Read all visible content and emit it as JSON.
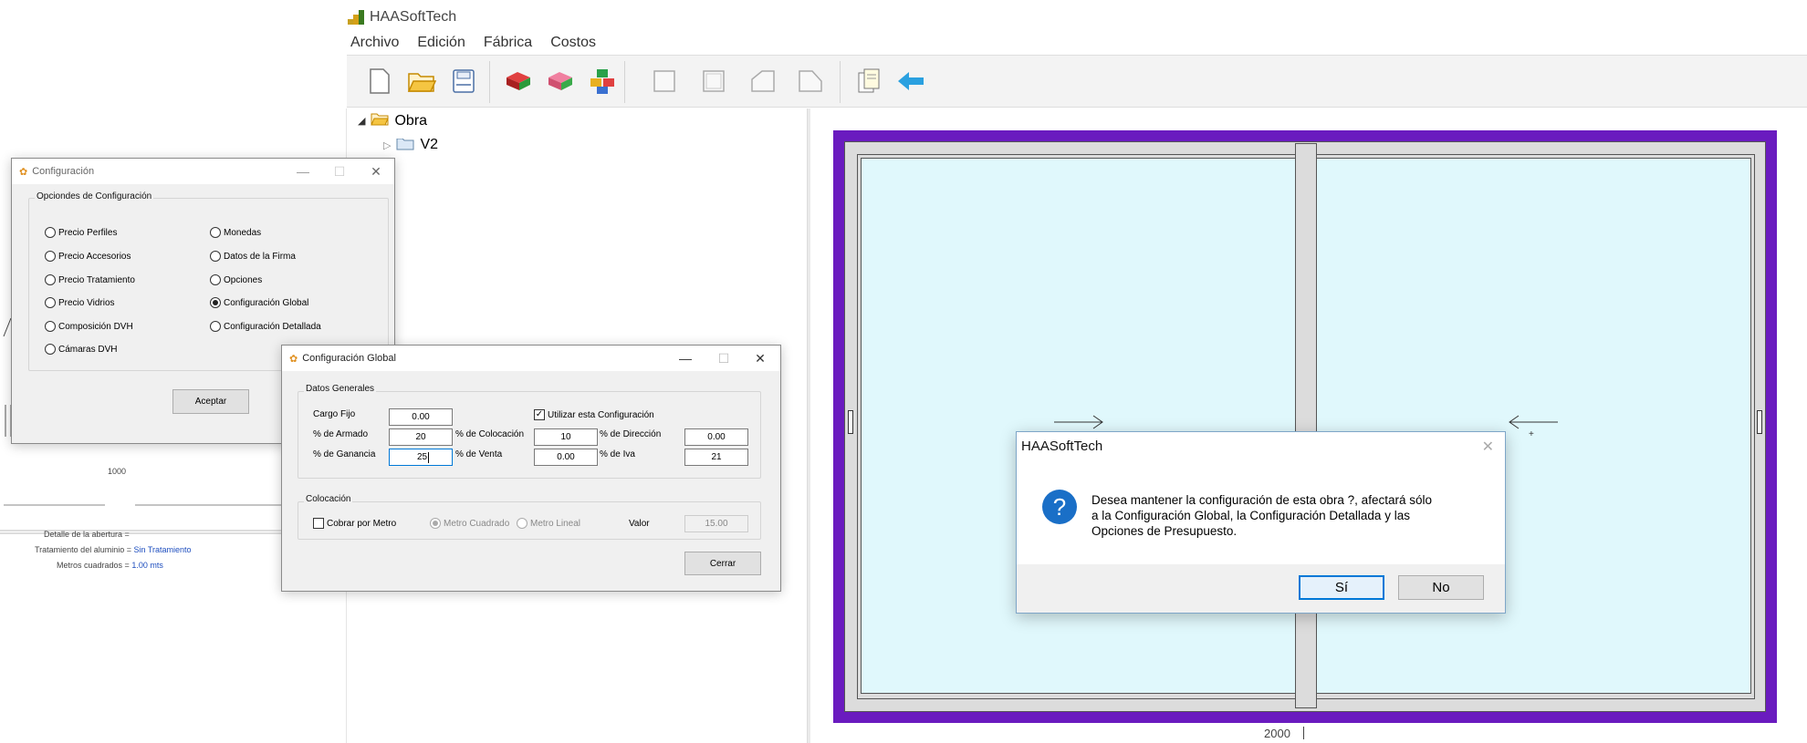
{
  "app": {
    "title": "HAASoftTech",
    "menu": [
      "Archivo",
      "Edición",
      "Fábrica",
      "Costos"
    ]
  },
  "tree": {
    "root": "Obra",
    "child": "V2"
  },
  "toolbar": {
    "icons": [
      "new-document-icon",
      "open-folder-icon",
      "save-icon",
      "bricks-red-icon",
      "bricks-pink-icon",
      "blocks-stack-icon",
      "window-blank-icon",
      "window-frame-icon",
      "window-angle-icon",
      "window-pentagon-icon",
      "document-copy-icon",
      "back-arrow-icon"
    ]
  },
  "left_panel": {
    "dimension": "1000",
    "details": {
      "line1_label": "Detalle de la abertura =",
      "line2_label": "Tratamiento del aluminio =",
      "line2_value": "Sin Tratamiento",
      "line3_label": "Metros cuadrados =",
      "line3_value": "1.00 mts"
    }
  },
  "drawing": {
    "width_label": "2000",
    "frame_color": "#6a1bbf",
    "glass_color": "#e0f8fc"
  },
  "config_window": {
    "title": "Configuración",
    "group_title": "Opciondes de Configuración",
    "options_left": [
      "Precio Perfiles",
      "Precio Accesorios",
      "Precio Tratamiento",
      "Precio Vidrios",
      "Composición DVH",
      "Cámaras DVH"
    ],
    "options_right": [
      "Monedas",
      "Datos de la Firma",
      "Opciones",
      "Configuración Global",
      "Configuración Detallada"
    ],
    "selected": "Configuración Global",
    "accept_label": "Aceptar"
  },
  "global_window": {
    "title": "Configuración Global",
    "datos_generales": {
      "group_title": "Datos Generales",
      "cargo_fijo_label": "Cargo Fijo",
      "cargo_fijo_value": "0.00",
      "armado_label": "% de Armado",
      "armado_value": "20",
      "ganancia_label": "% de Ganancia",
      "ganancia_value": "25",
      "utilizar_label": "Utilizar esta Configuración",
      "utilizar_checked": true,
      "colocacion_label": "% de Colocación",
      "colocacion_value": "10",
      "venta_label": "% de Venta",
      "venta_value": "0.00",
      "direccion_label": "% de Dirección",
      "direccion_value": "0.00",
      "iva_label": "% de Iva",
      "iva_value": "21"
    },
    "colocacion": {
      "group_title": "Colocación",
      "cobrar_label": "Cobrar por Metro",
      "cobrar_checked": false,
      "metro_cuadrado_label": "Metro Cuadrado",
      "metro_lineal_label": "Metro Lineal",
      "valor_label": "Valor",
      "valor_value": "15.00"
    },
    "close_label": "Cerrar"
  },
  "message_box": {
    "title": "HAASoftTech",
    "message_line1": "Desea mantener la configuración de esta obra ?, afectará sólo",
    "message_line2": "a la Configuración Global, la Configuración Detallada y las",
    "message_line3": "Opciones de Presupuesto.",
    "yes_label": "Sí",
    "no_label": "No",
    "icon": "question-icon"
  },
  "window_controls": {
    "minimize": "—",
    "maximize": "☐",
    "close": "✕"
  }
}
